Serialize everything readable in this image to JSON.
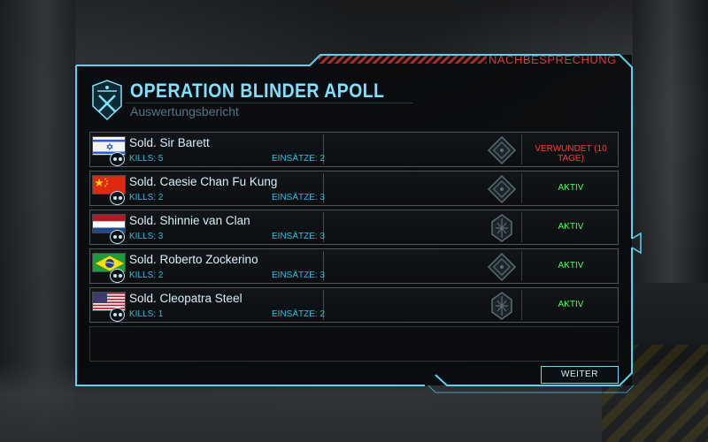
{
  "header": {
    "tag": "NACHBESPRECHUNG",
    "title": "OPERATION BLINDER APOLL",
    "subtitle": "Auswertungsbericht"
  },
  "soldiers": [
    {
      "name": "Sold. Sir Barett",
      "kills": "KILLS: 5",
      "missions": "EINSÄTZE: 2",
      "status": "VERWUNDET (10 TAGE)",
      "status_type": "wounded",
      "flag": "israel",
      "rank_icon": "squaddie-rank-icon"
    },
    {
      "name": "Sold. Caesie Chan Fu Kung",
      "kills": "KILLS: 2",
      "missions": "EINSÄTZE: 3",
      "status": "AKTIV",
      "status_type": "active",
      "flag": "china",
      "rank_icon": "squaddie-rank-icon"
    },
    {
      "name": "Sold. Shinnie van Clan",
      "kills": "KILLS: 3",
      "missions": "EINSÄTZE: 3",
      "status": "AKTIV",
      "status_type": "active",
      "flag": "netherlands",
      "rank_icon": "sniper-class-icon"
    },
    {
      "name": "Sold. Roberto Zockerino",
      "kills": "KILLS: 2",
      "missions": "EINSÄTZE: 3",
      "status": "AKTIV",
      "status_type": "active",
      "flag": "brazil",
      "rank_icon": "squaddie-rank-icon"
    },
    {
      "name": "Sold. Cleopatra Steel",
      "kills": "KILLS: 1",
      "missions": "EINSÄTZE: 2",
      "status": "AKTIV",
      "status_type": "active",
      "flag": "usa",
      "rank_icon": "sniper-class-icon"
    }
  ],
  "footer": {
    "continue_label": "WEITER"
  },
  "colors": {
    "frame": "#5ad2f0",
    "title": "#7fe0ff",
    "wounded": "#ff3a33",
    "active": "#4cff5c",
    "tag": "#e0383a"
  }
}
